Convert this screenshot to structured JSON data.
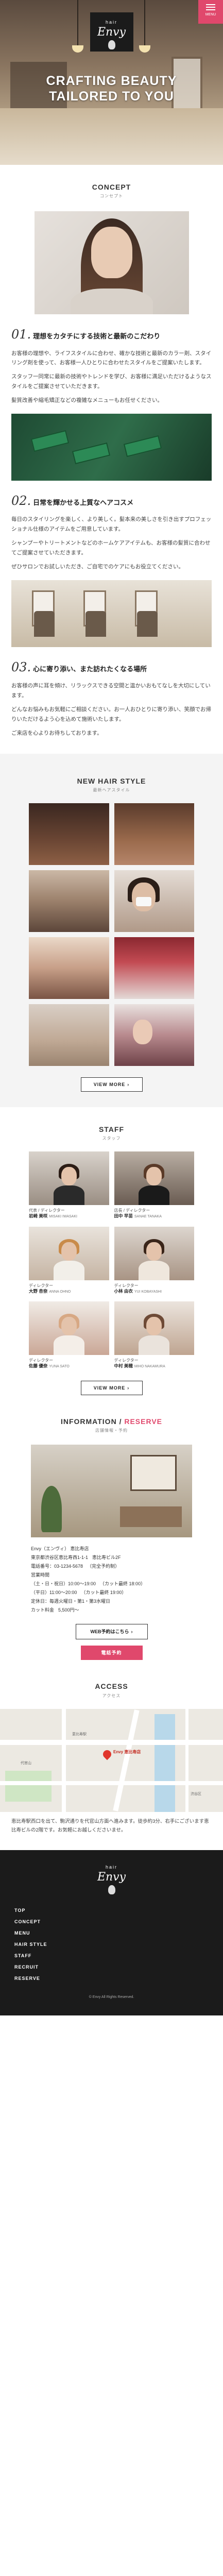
{
  "header": {
    "logo_top": "hair",
    "logo_brand": "Envy",
    "menu_label": "MENU",
    "hero_copy_line1": "CRAFTING BEAUTY",
    "hero_copy_line2": "TAILORED TO YOU"
  },
  "concept": {
    "title": "CONCEPT",
    "subtitle": "コンセプト",
    "points": [
      {
        "num": "01.",
        "heading": "理想をカタチにする技術と最新のこだわり",
        "body": "お客様の理想や、ライフスタイルに合わせ、確かな技術と最新のカラー剤、スタイリング剤を使って、お客様一人ひとりに合わせたスタイルをご提案いたします。",
        "body2": "スタッフ一同常に最新の技術やトレンドを学び、お客様に満足いただけるようなスタイルをご提案させていただきます。",
        "body3": "髪質改善や縮毛矯正などの複雑なメニューもお任せください。"
      },
      {
        "num": "02.",
        "heading": "日常を輝かせる上質なヘアコスメ",
        "body": "毎日のスタイリングを楽しく、より美しく。髪本来の美しさを引き出すプロフェッショナル仕様のアイテムをご用意しています。",
        "body2": "シャンプーやトリートメントなどのホームケアアイテムも、お客様の髪質に合わせてご提案させていただきます。",
        "body3": "ぜひサロンでお試しいただき、ご自宅でのケアにもお役立てください。"
      },
      {
        "num": "03.",
        "heading": "心に寄り添い、また訪れたくなる場所",
        "body": "お客様の声に耳を傾け、リラックスできる空間と温かいおもてなしを大切にしています。",
        "body2": "どんなお悩みもお気軽にご相談ください。お一人おひとりに寄り添い、笑顔でお帰りいただけるよう心を込めて施術いたします。",
        "body3": "ご来店を心よりお待ちしております。"
      }
    ]
  },
  "style": {
    "title": "NEW HAIR STYLE",
    "subtitle": "最新ヘアスタイル",
    "more": "VIEW MORE"
  },
  "staff": {
    "title": "STAFF",
    "subtitle": "スタッフ",
    "members": [
      {
        "role": "代表 / ディレクター",
        "name": "岩崎 美咲",
        "en": "MISAKI IWASAKI"
      },
      {
        "role": "店長 / ディレクター",
        "name": "田中 早苗",
        "en": "SANAE TANAKA"
      },
      {
        "role": "ディレクター",
        "name": "大野 杏奈",
        "en": "ANNA OHNO"
      },
      {
        "role": "ディレクター",
        "name": "小林 由衣",
        "en": "YUI KOBAYASHI"
      },
      {
        "role": "ディレクター",
        "name": "佐藤 優奈",
        "en": "YUNA SATO"
      },
      {
        "role": "ディレクター",
        "name": "中村 美穂",
        "en": "MIHO NAKAMURA"
      }
    ],
    "more": "VIEW MORE"
  },
  "info": {
    "title_a": "INFORMATION",
    "title_sep": " / ",
    "title_b": "RESERVE",
    "subtitle": "店舗情報・予約",
    "rows": [
      {
        "k": "Envy（エンヴィ） 恵比寿店",
        "v": ""
      },
      {
        "k": "東京都渋谷区恵比寿西1-1-1",
        "v": "恵比寿ビル2F"
      },
      {
        "k": "電話番号：03-1234-5678",
        "v": "（完全予約制）"
      },
      {
        "k": "営業時間",
        "v": ""
      },
      {
        "k": "（土・日・祝日）10:00～19:00",
        "v": "（カット最終 18:00）"
      },
      {
        "k": "（平日）11:00～20:00",
        "v": "（カット最終 19:00）"
      },
      {
        "k": "定休日：毎週火曜日・第1・第3水曜日",
        "v": ""
      },
      {
        "k": "カット料金",
        "v": "5,500円～"
      }
    ],
    "web_btn": "WEB予約はこちら",
    "tel_btn": "電話予約"
  },
  "access": {
    "title": "ACCESS",
    "subtitle": "アクセス",
    "pin_label": "Envy 恵比寿店",
    "map_labels": [
      "恵比寿駅",
      "代官山",
      "渋谷区"
    ],
    "text": "恵比寿駅西口を出て、駒沢通りを代官山方面へ進みます。徒歩約3分、右手にございます恵比寿ビルの2階です。お気軽にお越しくださいませ。"
  },
  "footer": {
    "nav": [
      "TOP",
      "CONCEPT",
      "MENU",
      "HAIR STYLE",
      "STAFF",
      "RECRUIT",
      "RESERVE"
    ],
    "copy": "© Envy All Rights Reserved."
  },
  "colors": {
    "accent": "#e0486c",
    "dark": "#1b1b1b"
  }
}
